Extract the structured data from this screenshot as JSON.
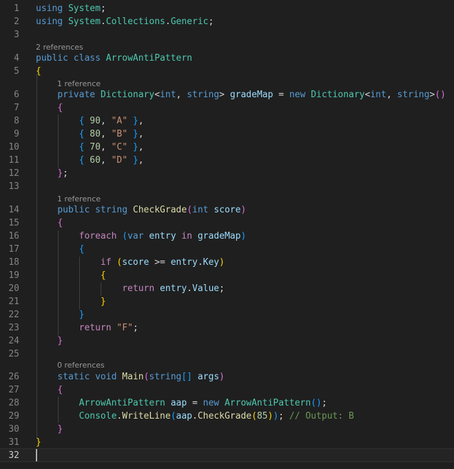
{
  "editor": {
    "language": "csharp",
    "active_line": "32",
    "codelens": [
      {
        "id": "class",
        "text": "2 references"
      },
      {
        "id": "grademap",
        "text": "1 reference"
      },
      {
        "id": "checkgrade",
        "text": "1 reference"
      },
      {
        "id": "main",
        "text": "0 references"
      }
    ],
    "lines": [
      {
        "n": "1",
        "tokens": [
          [
            "kw",
            "using"
          ],
          [
            "pn",
            " "
          ],
          [
            "ty",
            "System"
          ],
          [
            "pn",
            ";"
          ]
        ]
      },
      {
        "n": "2",
        "tokens": [
          [
            "kw",
            "using"
          ],
          [
            "pn",
            " "
          ],
          [
            "ty",
            "System"
          ],
          [
            "pn",
            "."
          ],
          [
            "ty",
            "Collections"
          ],
          [
            "pn",
            "."
          ],
          [
            "ty",
            "Generic"
          ],
          [
            "pn",
            ";"
          ]
        ]
      },
      {
        "n": "3",
        "tokens": []
      },
      {
        "n": "4",
        "tokens": [
          [
            "kw",
            "public"
          ],
          [
            "pn",
            " "
          ],
          [
            "kw",
            "class"
          ],
          [
            "pn",
            " "
          ],
          [
            "ty",
            "ArrowAntiPattern"
          ]
        ]
      },
      {
        "n": "5",
        "tokens": [
          [
            "b1",
            "{"
          ]
        ]
      },
      {
        "n": "6",
        "tokens": [
          [
            "pn",
            "    "
          ],
          [
            "kw",
            "private"
          ],
          [
            "pn",
            " "
          ],
          [
            "ty",
            "Dictionary"
          ],
          [
            "pn",
            "<"
          ],
          [
            "kw",
            "int"
          ],
          [
            "pn",
            ", "
          ],
          [
            "kw",
            "string"
          ],
          [
            "pn",
            "> "
          ],
          [
            "vr",
            "gradeMap"
          ],
          [
            "pn",
            " = "
          ],
          [
            "kw",
            "new"
          ],
          [
            "pn",
            " "
          ],
          [
            "ty",
            "Dictionary"
          ],
          [
            "pn",
            "<"
          ],
          [
            "kw",
            "int"
          ],
          [
            "pn",
            ", "
          ],
          [
            "kw",
            "string"
          ],
          [
            "pn",
            ">"
          ],
          [
            "b2",
            "()"
          ]
        ]
      },
      {
        "n": "7",
        "tokens": [
          [
            "pn",
            "    "
          ],
          [
            "b2",
            "{"
          ]
        ]
      },
      {
        "n": "8",
        "tokens": [
          [
            "pn",
            "        "
          ],
          [
            "b3",
            "{"
          ],
          [
            "pn",
            " "
          ],
          [
            "num",
            "90"
          ],
          [
            "pn",
            ", "
          ],
          [
            "str",
            "\"A\""
          ],
          [
            "pn",
            " "
          ],
          [
            "b3",
            "}"
          ],
          [
            "pn",
            ","
          ]
        ]
      },
      {
        "n": "9",
        "tokens": [
          [
            "pn",
            "        "
          ],
          [
            "b3",
            "{"
          ],
          [
            "pn",
            " "
          ],
          [
            "num",
            "80"
          ],
          [
            "pn",
            ", "
          ],
          [
            "str",
            "\"B\""
          ],
          [
            "pn",
            " "
          ],
          [
            "b3",
            "}"
          ],
          [
            "pn",
            ","
          ]
        ]
      },
      {
        "n": "10",
        "tokens": [
          [
            "pn",
            "        "
          ],
          [
            "b3",
            "{"
          ],
          [
            "pn",
            " "
          ],
          [
            "num",
            "70"
          ],
          [
            "pn",
            ", "
          ],
          [
            "str",
            "\"C\""
          ],
          [
            "pn",
            " "
          ],
          [
            "b3",
            "}"
          ],
          [
            "pn",
            ","
          ]
        ]
      },
      {
        "n": "11",
        "tokens": [
          [
            "pn",
            "        "
          ],
          [
            "b3",
            "{"
          ],
          [
            "pn",
            " "
          ],
          [
            "num",
            "60"
          ],
          [
            "pn",
            ", "
          ],
          [
            "str",
            "\"D\""
          ],
          [
            "pn",
            " "
          ],
          [
            "b3",
            "}"
          ],
          [
            "pn",
            ","
          ]
        ]
      },
      {
        "n": "12",
        "tokens": [
          [
            "pn",
            "    "
          ],
          [
            "b2",
            "}"
          ],
          [
            "pn",
            ";"
          ]
        ]
      },
      {
        "n": "13",
        "tokens": []
      },
      {
        "n": "14",
        "tokens": [
          [
            "pn",
            "    "
          ],
          [
            "kw",
            "public"
          ],
          [
            "pn",
            " "
          ],
          [
            "kw",
            "string"
          ],
          [
            "pn",
            " "
          ],
          [
            "fn",
            "CheckGrade"
          ],
          [
            "b2",
            "("
          ],
          [
            "kw",
            "int"
          ],
          [
            "pn",
            " "
          ],
          [
            "vr",
            "score"
          ],
          [
            "b2",
            ")"
          ]
        ]
      },
      {
        "n": "15",
        "tokens": [
          [
            "pn",
            "    "
          ],
          [
            "b2",
            "{"
          ]
        ]
      },
      {
        "n": "16",
        "tokens": [
          [
            "pn",
            "        "
          ],
          [
            "ctrl",
            "foreach"
          ],
          [
            "pn",
            " "
          ],
          [
            "b3",
            "("
          ],
          [
            "kw",
            "var"
          ],
          [
            "pn",
            " "
          ],
          [
            "vr",
            "entry"
          ],
          [
            "pn",
            " "
          ],
          [
            "ctrl",
            "in"
          ],
          [
            "pn",
            " "
          ],
          [
            "vr",
            "gradeMap"
          ],
          [
            "b3",
            ")"
          ]
        ]
      },
      {
        "n": "17",
        "tokens": [
          [
            "pn",
            "        "
          ],
          [
            "b3",
            "{"
          ]
        ]
      },
      {
        "n": "18",
        "tokens": [
          [
            "pn",
            "            "
          ],
          [
            "ctrl",
            "if"
          ],
          [
            "pn",
            " "
          ],
          [
            "b1",
            "("
          ],
          [
            "vr",
            "score"
          ],
          [
            "pn",
            " >= "
          ],
          [
            "vr",
            "entry"
          ],
          [
            "pn",
            "."
          ],
          [
            "vr",
            "Key"
          ],
          [
            "b1",
            ")"
          ]
        ]
      },
      {
        "n": "19",
        "tokens": [
          [
            "pn",
            "            "
          ],
          [
            "b1",
            "{"
          ]
        ]
      },
      {
        "n": "20",
        "tokens": [
          [
            "pn",
            "                "
          ],
          [
            "ctrl",
            "return"
          ],
          [
            "pn",
            " "
          ],
          [
            "vr",
            "entry"
          ],
          [
            "pn",
            "."
          ],
          [
            "vr",
            "Value"
          ],
          [
            "pn",
            ";"
          ]
        ]
      },
      {
        "n": "21",
        "tokens": [
          [
            "pn",
            "            "
          ],
          [
            "b1",
            "}"
          ]
        ]
      },
      {
        "n": "22",
        "tokens": [
          [
            "pn",
            "        "
          ],
          [
            "b3",
            "}"
          ]
        ]
      },
      {
        "n": "23",
        "tokens": [
          [
            "pn",
            "        "
          ],
          [
            "ctrl",
            "return"
          ],
          [
            "pn",
            " "
          ],
          [
            "str",
            "\"F\""
          ],
          [
            "pn",
            ";"
          ]
        ]
      },
      {
        "n": "24",
        "tokens": [
          [
            "pn",
            "    "
          ],
          [
            "b2",
            "}"
          ]
        ]
      },
      {
        "n": "25",
        "tokens": []
      },
      {
        "n": "26",
        "tokens": [
          [
            "pn",
            "    "
          ],
          [
            "kw",
            "static"
          ],
          [
            "pn",
            " "
          ],
          [
            "kw",
            "void"
          ],
          [
            "pn",
            " "
          ],
          [
            "fn",
            "Main"
          ],
          [
            "b2",
            "("
          ],
          [
            "kw",
            "string"
          ],
          [
            "b3",
            "[]"
          ],
          [
            "pn",
            " "
          ],
          [
            "vr",
            "args"
          ],
          [
            "b2",
            ")"
          ]
        ]
      },
      {
        "n": "27",
        "tokens": [
          [
            "pn",
            "    "
          ],
          [
            "b2",
            "{"
          ]
        ]
      },
      {
        "n": "28",
        "tokens": [
          [
            "pn",
            "        "
          ],
          [
            "ty",
            "ArrowAntiPattern"
          ],
          [
            "pn",
            " "
          ],
          [
            "vr",
            "aap"
          ],
          [
            "pn",
            " = "
          ],
          [
            "kw",
            "new"
          ],
          [
            "pn",
            " "
          ],
          [
            "ty",
            "ArrowAntiPattern"
          ],
          [
            "b3",
            "()"
          ],
          [
            "pn",
            ";"
          ]
        ]
      },
      {
        "n": "29",
        "tokens": [
          [
            "pn",
            "        "
          ],
          [
            "ty",
            "Console"
          ],
          [
            "pn",
            "."
          ],
          [
            "fn",
            "WriteLine"
          ],
          [
            "b3",
            "("
          ],
          [
            "vr",
            "aap"
          ],
          [
            "pn",
            "."
          ],
          [
            "fn",
            "CheckGrade"
          ],
          [
            "b1",
            "("
          ],
          [
            "num",
            "85"
          ],
          [
            "b1",
            ")"
          ],
          [
            "b3",
            ")"
          ],
          [
            "pn",
            "; "
          ],
          [
            "cm",
            "// Output: B"
          ]
        ]
      },
      {
        "n": "30",
        "tokens": [
          [
            "pn",
            "    "
          ],
          [
            "b2",
            "}"
          ]
        ]
      },
      {
        "n": "31",
        "tokens": [
          [
            "b1",
            "}"
          ]
        ]
      },
      {
        "n": "32",
        "tokens": []
      }
    ]
  }
}
